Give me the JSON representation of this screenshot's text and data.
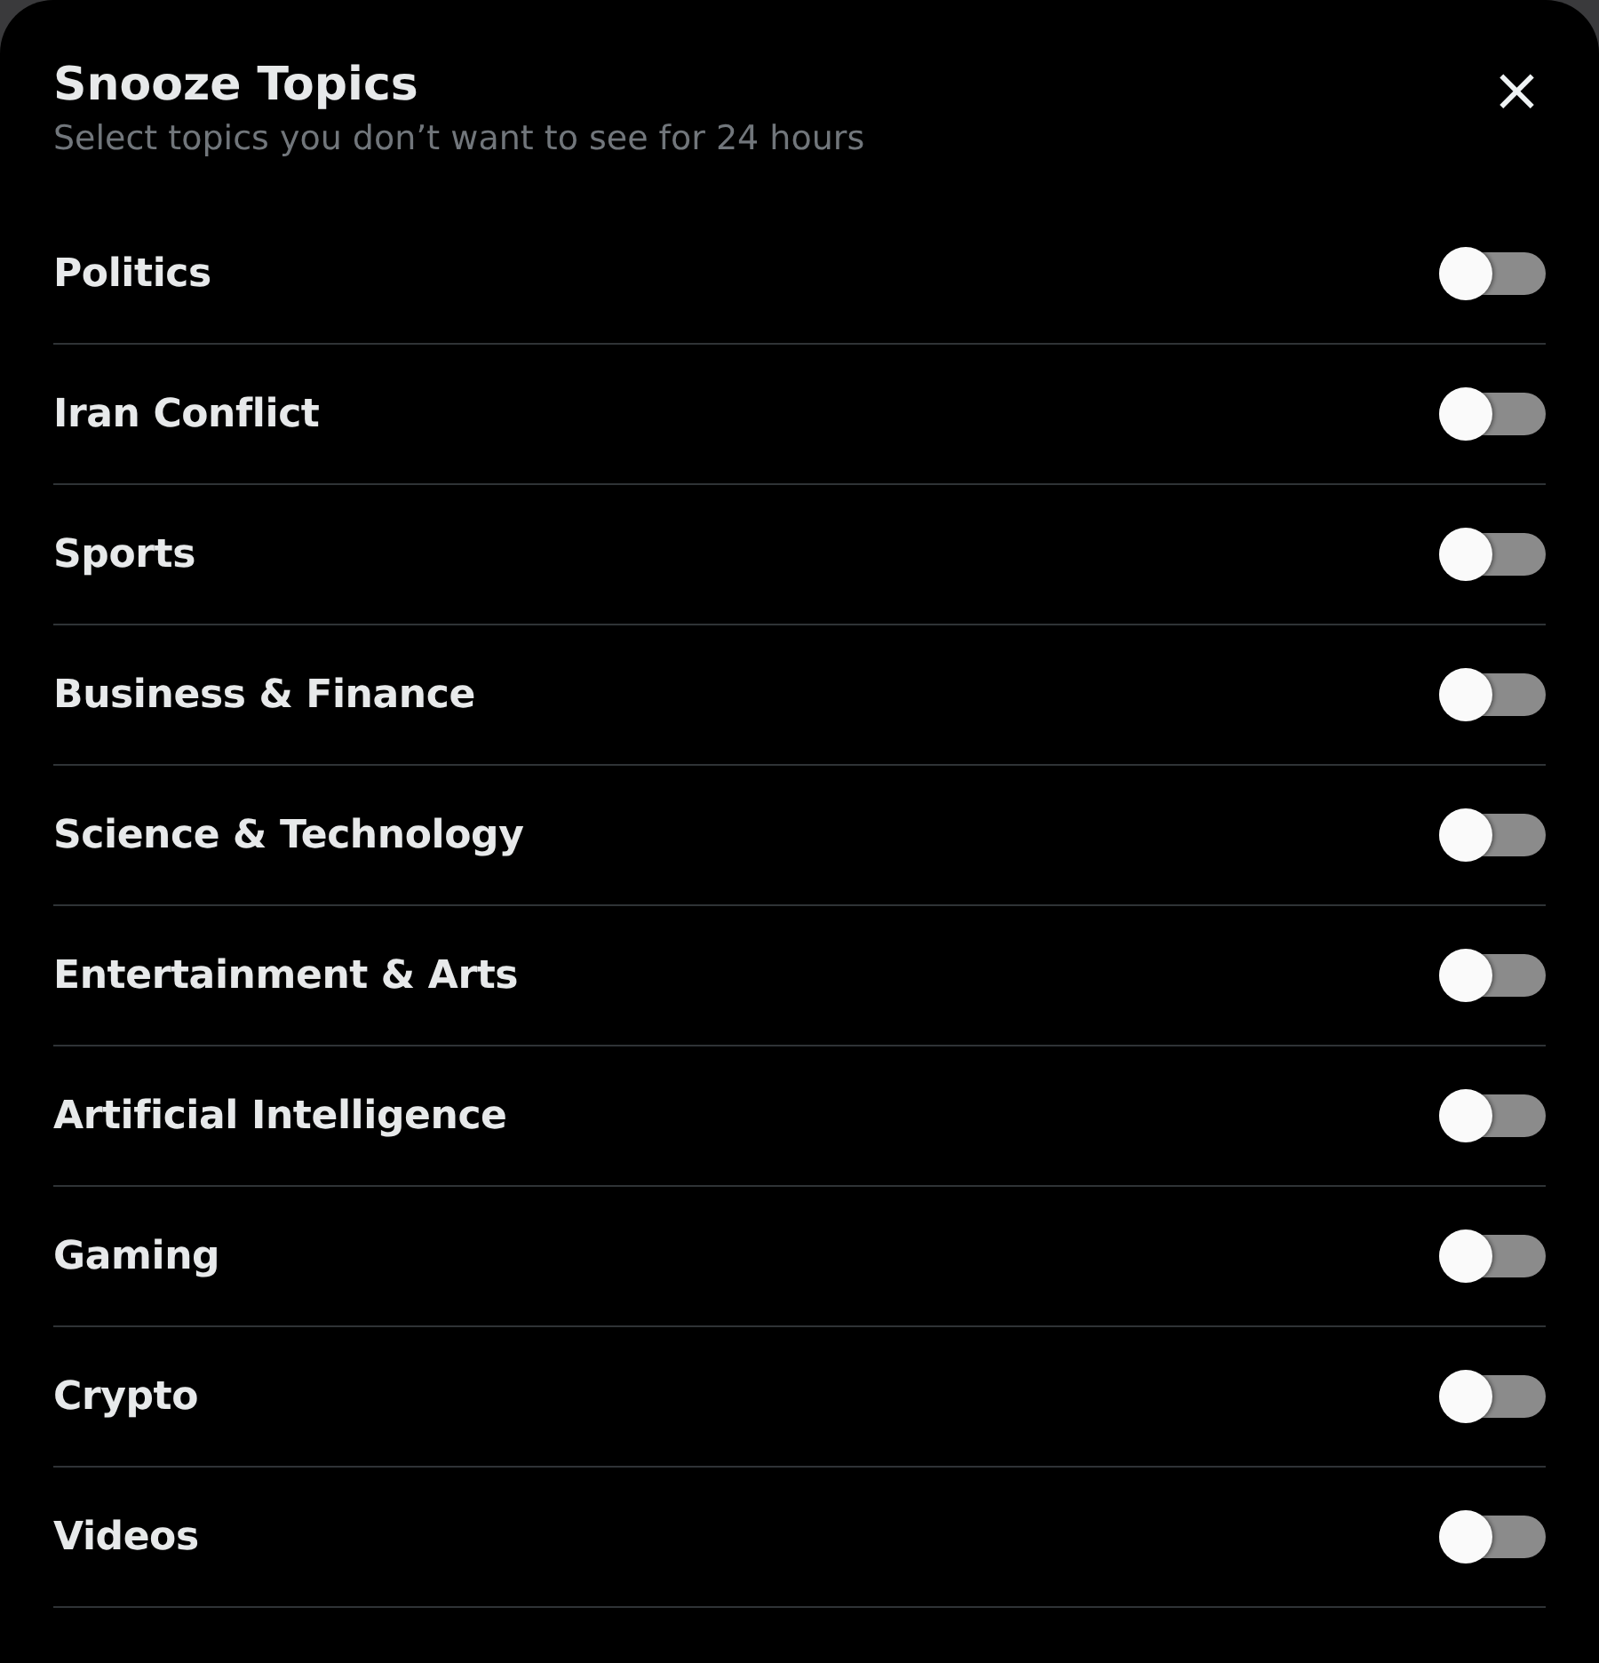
{
  "dialog": {
    "title": "Snooze Topics",
    "subtitle": "Select topics you don’t want to see for 24 hours",
    "close_icon": "×"
  },
  "topics": [
    {
      "label": "Politics",
      "on": false
    },
    {
      "label": "Iran Conflict",
      "on": false
    },
    {
      "label": "Sports",
      "on": false
    },
    {
      "label": "Business & Finance",
      "on": false
    },
    {
      "label": "Science & Technology",
      "on": false
    },
    {
      "label": "Entertainment & Arts",
      "on": false
    },
    {
      "label": "Artificial Intelligence",
      "on": false
    },
    {
      "label": "Gaming",
      "on": false
    },
    {
      "label": "Crypto",
      "on": false
    },
    {
      "label": "Videos",
      "on": false
    }
  ]
}
